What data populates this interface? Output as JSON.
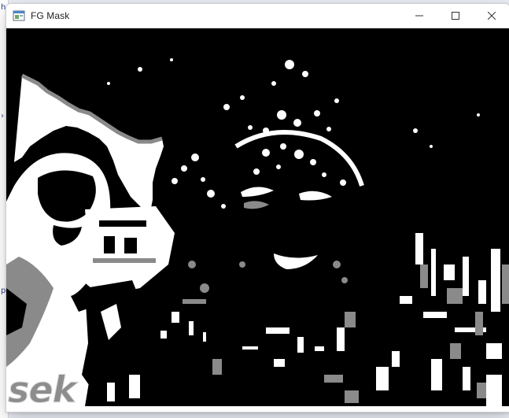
{
  "window": {
    "title": "FG Mask",
    "app_icon": "opencv-window-icon",
    "controls": {
      "minimize_icon": "minimize-icon",
      "maximize_icon": "maximize-icon",
      "close_icon": "close-icon"
    }
  },
  "image": {
    "description_type": "foreground-mask",
    "colors": {
      "background": "#000000",
      "foreground": "#ffffff",
      "shadow": "#8a8a8a"
    },
    "overlay_text": "sek"
  },
  "background_app": {
    "glyphs": [
      "h",
      "›",
      "p"
    ]
  }
}
